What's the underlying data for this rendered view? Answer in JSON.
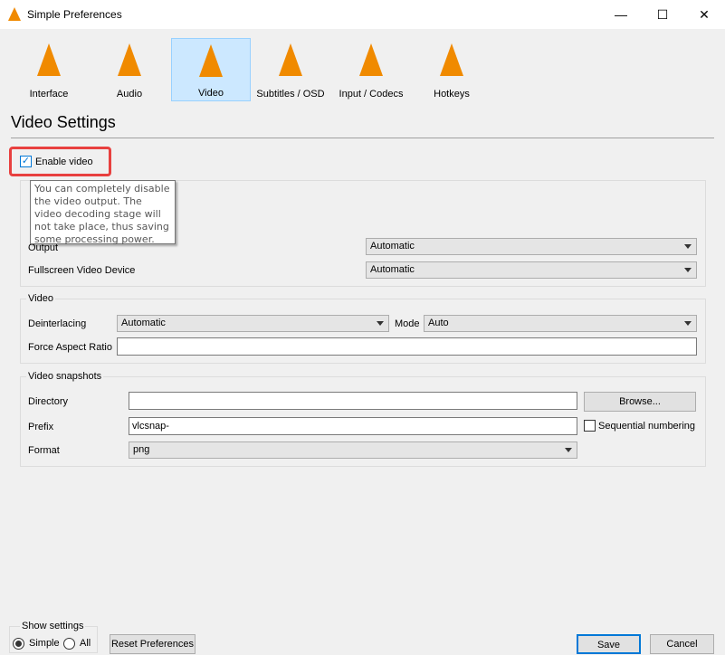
{
  "window": {
    "title": "Simple Preferences",
    "minimize": "—",
    "maximize": "☐",
    "close": "✕"
  },
  "tabs": [
    {
      "label": "Interface",
      "icon": "interface-cone-icon"
    },
    {
      "label": "Audio",
      "icon": "audio-cone-icon"
    },
    {
      "label": "Video",
      "icon": "video-cone-icon",
      "selected": true
    },
    {
      "label": "Subtitles / OSD",
      "icon": "subtitles-cone-icon"
    },
    {
      "label": "Input / Codecs",
      "icon": "input-cone-icon"
    },
    {
      "label": "Hotkeys",
      "icon": "hotkeys-cone-icon"
    }
  ],
  "section_title": "Video Settings",
  "enable_video": {
    "label": "Enable video",
    "checked": true,
    "highlight_color": "#e8403f"
  },
  "tooltip": "You can completely disable the video output. The video decoding stage will not take place, thus saving some processing power.",
  "display": {
    "output_label": "Output",
    "output_value": "Automatic",
    "fullscreen_label": "Fullscreen Video Device",
    "fullscreen_value": "Automatic"
  },
  "video": {
    "legend": "Video",
    "deinterlacing_label": "Deinterlacing",
    "deinterlacing_value": "Automatic",
    "mode_label": "Mode",
    "mode_value": "Auto",
    "aspect_label": "Force Aspect Ratio",
    "aspect_value": ""
  },
  "snapshots": {
    "legend": "Video snapshots",
    "directory_label": "Directory",
    "directory_value": "",
    "browse": "Browse...",
    "prefix_label": "Prefix",
    "prefix_value": "vlcsnap-",
    "sequential_label": "Sequential numbering",
    "sequential_checked": false,
    "format_label": "Format",
    "format_value": "png"
  },
  "footer": {
    "show_settings": "Show settings",
    "simple": "Simple",
    "all": "All",
    "selected": "Simple",
    "reset": "Reset Preferences",
    "save": "Save",
    "cancel": "Cancel"
  }
}
